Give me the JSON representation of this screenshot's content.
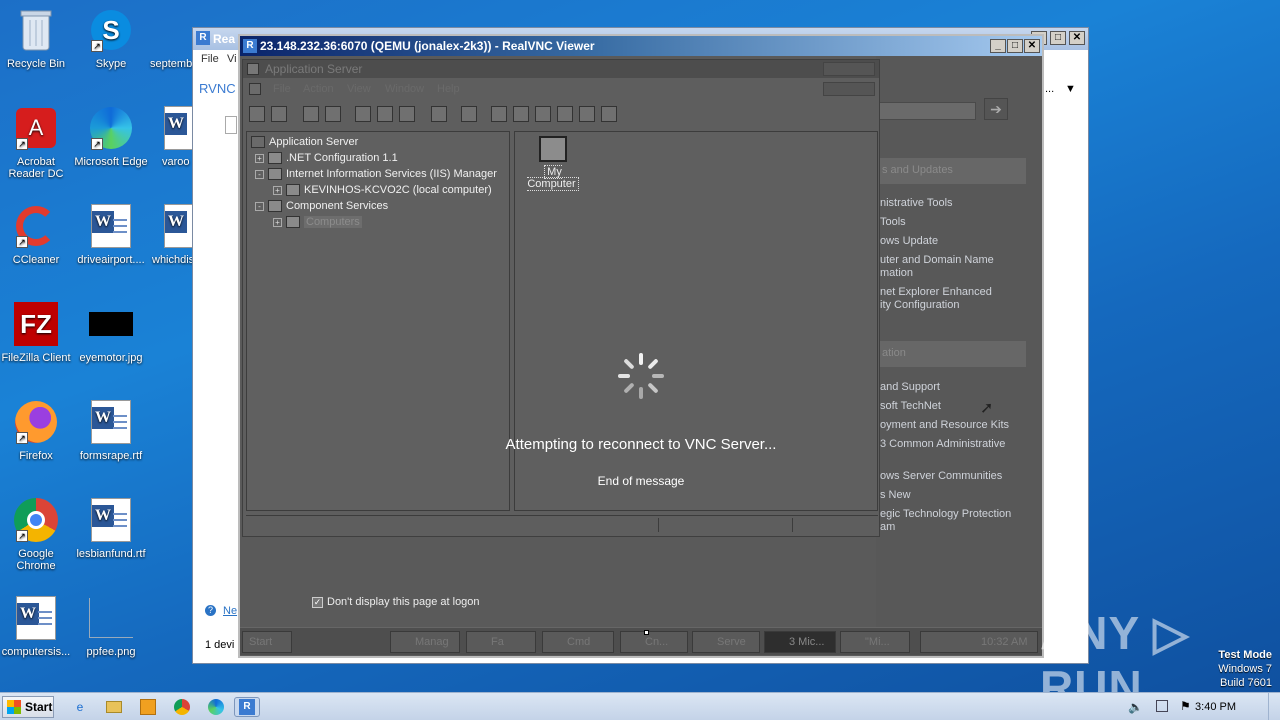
{
  "desktop": {
    "icons": [
      {
        "label": "Recycle Bin"
      },
      {
        "label": "Skype"
      },
      {
        "label": "septemb"
      },
      {
        "label": "Acrobat Reader DC"
      },
      {
        "label": "Microsoft Edge"
      },
      {
        "label": "varoo"
      },
      {
        "label": "CCleaner"
      },
      {
        "label": "driveairport...."
      },
      {
        "label": "whichdis"
      },
      {
        "label": "FileZilla Client"
      },
      {
        "label": "eyemotor.jpg"
      },
      {
        "label": "Firefox"
      },
      {
        "label": "formsrape.rtf"
      },
      {
        "label": "Google Chrome"
      },
      {
        "label": "lesbianfund.rtf"
      },
      {
        "label": "computersis..."
      },
      {
        "label": "ppfee.png"
      }
    ]
  },
  "bg_window": {
    "title": "Rea",
    "menu_file": "File",
    "menu_v": "Vi",
    "brand": "RVNC",
    "link_partial": "Ne",
    "status_partial": "1 devi",
    "more_label": "..."
  },
  "vnc_window": {
    "title": "23.148.232.36:6070 (QEMU (jonalex-2k3)) - RealVNC Viewer",
    "logo": "R",
    "min": "_",
    "max": "□",
    "close": "✕"
  },
  "remote": {
    "mmc": {
      "title": "Application Server",
      "menu": [
        "File",
        "Action",
        "View",
        "Window",
        "Help"
      ],
      "tree": [
        {
          "label": "Application Server",
          "expander": ""
        },
        {
          "label": ".NET Configuration 1.1",
          "expander": "+"
        },
        {
          "label": "Internet Information Services (IIS) Manager",
          "expander": "-"
        },
        {
          "label": "KEVINHOS-KCVO2C (local computer)",
          "expander": "+"
        },
        {
          "label": "Component Services",
          "expander": "-"
        },
        {
          "label": "Computers",
          "expander": "+"
        }
      ],
      "list_item": "My Computer"
    },
    "right_panel": {
      "heading1": "s and Updates",
      "links1": [
        "nistrative Tools",
        "Tools",
        "ows Update",
        "uter and Domain Name",
        "mation",
        "net Explorer Enhanced",
        "ity Configuration"
      ],
      "heading2": "ation",
      "links2": [
        "and Support",
        "soft TechNet",
        "oyment and Resource Kits",
        "3 Common Administrative",
        "",
        "ows Server Communities",
        "s New",
        "egic Technology Protection",
        "am"
      ]
    },
    "logon_checkbox": "Don't display this page at logon",
    "taskbar": {
      "start": "Start",
      "items": [
        "Manag",
        "Fa",
        "Cmd",
        "Cn...",
        "Serve",
        "3 Mic...",
        "\"Mi...",
        "10:32 AM"
      ]
    }
  },
  "overlay": {
    "reconnect": "Attempting to reconnect to VNC Server...",
    "end": "End of message"
  },
  "taskbar": {
    "start": "Start",
    "clock": "3:40 PM"
  },
  "watermark": "ANY ▷ RUN",
  "testmode": {
    "line1": "Test Mode",
    "line2": "Windows 7",
    "line3": "Build 7601"
  }
}
